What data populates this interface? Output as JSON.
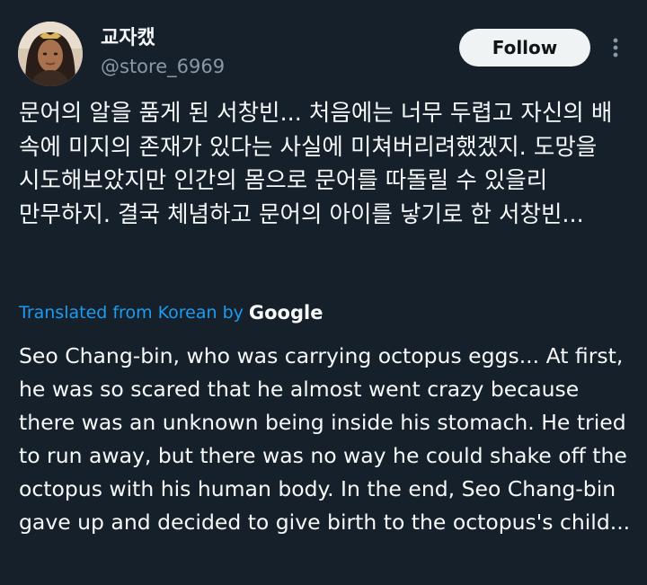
{
  "post": {
    "author": {
      "display_name": "교자캤",
      "handle": "@store_6969"
    },
    "follow_label": "Follow",
    "more_icon": "more-vertical-icon",
    "original_text": "문어의 알을 품게 된 서창빈... 처음에는 너무 두렵고 자신의 배 속에 미지의 존재가 있다는 사실에 미쳐버리려했겠지. 도망을 시도해보았지만 인간의 몸으로 문어를 따돌릴 수 있을리 만무하지. 결국 체념하고 문어의 아이를 낳기로 한 서창빈...",
    "translation": {
      "label": "Translated from Korean by",
      "provider": "Google",
      "text": "Seo Chang-bin, who was carrying octopus eggs... At first, he was so scared that he almost went crazy because there was an unknown being inside his stomach. He tried to run away, but there was no way he could shake off the octopus with his human body. In the end, Seo Chang-bin gave up and decided to give birth to the octopus's child..."
    }
  },
  "colors": {
    "background": "#15202b",
    "text": "#f7f9f9",
    "secondary_text": "#8b98a5",
    "link": "#1d9bf0",
    "button_bg": "#eff3f4",
    "button_text": "#0f1419"
  }
}
